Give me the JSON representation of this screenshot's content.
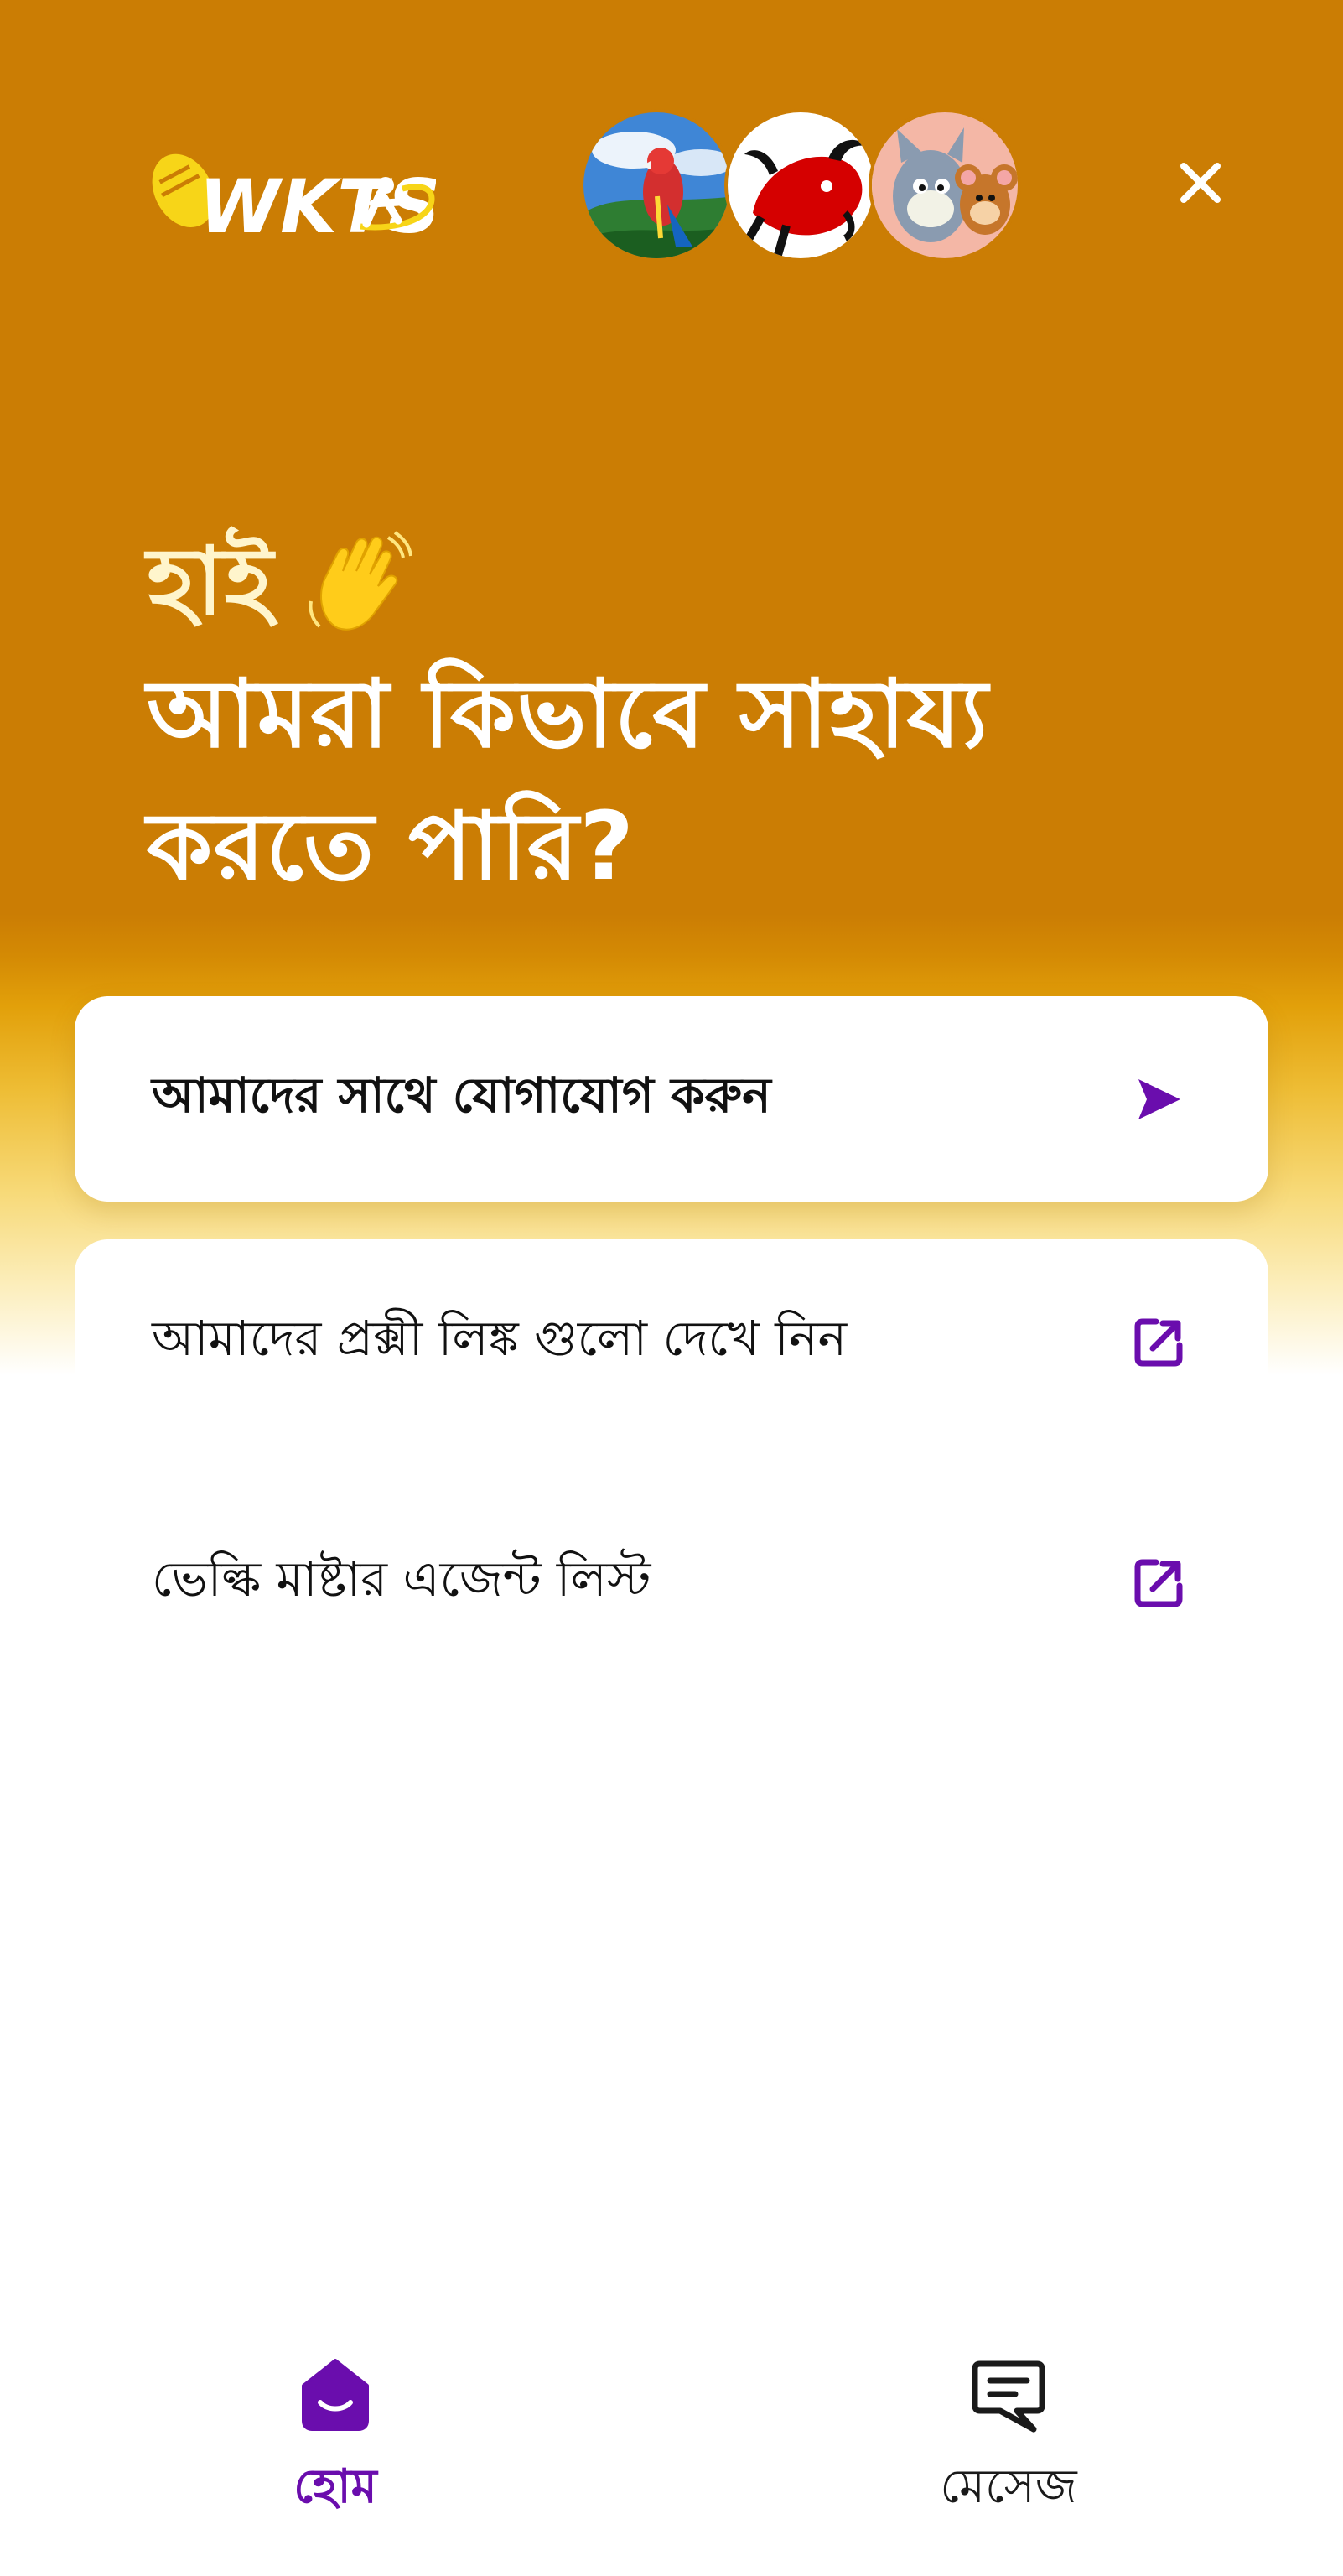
{
  "brand": {
    "logo_text": "WKTS",
    "colors": {
      "header_bg": "#cb7d04",
      "accent": "#6a0dad",
      "logo_yellow": "#f7d518"
    }
  },
  "header": {
    "avatars": [
      "parrot-avatar",
      "bull-avatar",
      "cartoon-cat-mouse-avatar"
    ],
    "close_icon": "close-icon"
  },
  "greeting": {
    "line1": "হাই",
    "line2": "আমরা কিভাবে সাহায্য",
    "line3": "করতে পারি?",
    "emoji": "waving-hand-icon"
  },
  "actions": [
    {
      "label": "আমাদের সাথে যোগাযোগ করুন",
      "icon": "send-arrow-icon"
    },
    {
      "label": "আমাদের প্রক্সী লিঙ্ক গুলো দেখে নিন",
      "icon": "external-link-icon"
    },
    {
      "label": "ভেল্কি মাষ্টার এজেন্ট লিস্ট",
      "icon": "external-link-icon"
    }
  ],
  "tabs": [
    {
      "label": "হোম",
      "icon": "home-icon",
      "active": true
    },
    {
      "label": "মেসেজ",
      "icon": "message-icon",
      "active": false
    }
  ]
}
